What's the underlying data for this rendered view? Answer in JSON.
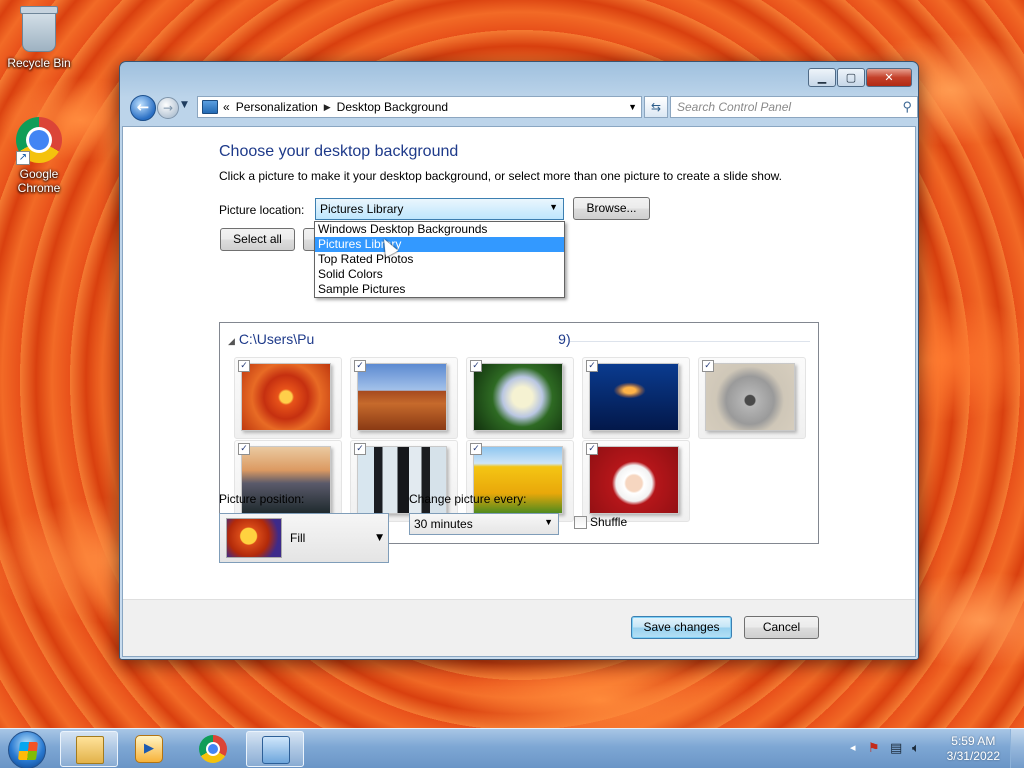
{
  "desktop": {
    "icons": [
      {
        "label": "Recycle Bin",
        "icon": "recycle-bin-icon"
      },
      {
        "label": "Google\nChrome",
        "icon": "chrome-icon"
      }
    ]
  },
  "window": {
    "address": {
      "overflow": "«",
      "crumbs": [
        "Personalization",
        "Desktop Background"
      ],
      "search_placeholder": "Search Control Panel"
    },
    "heading": "Choose your desktop background",
    "description": "Click a picture to make it your desktop background, or select more than one picture to create a slide show.",
    "picture_location_label": "Picture location:",
    "picture_location_value": "Pictures Library",
    "browse_label": "Browse...",
    "select_all_label": "Select all",
    "group_header": "C:\\Users\\Pu",
    "group_header_tail": "9)",
    "dropdown_options": [
      "Windows Desktop Backgrounds",
      "Pictures Library",
      "Top Rated Photos",
      "Solid Colors",
      "Sample Pictures"
    ],
    "dropdown_selected_index": 1,
    "pictures": [
      {
        "name": "Chrysanthemum",
        "checked": true
      },
      {
        "name": "Desert",
        "checked": true
      },
      {
        "name": "Hydrangeas",
        "checked": true
      },
      {
        "name": "Jellyfish",
        "checked": true
      },
      {
        "name": "Koala",
        "checked": true
      },
      {
        "name": "Lighthouse",
        "checked": true
      },
      {
        "name": "Penguins",
        "checked": true
      },
      {
        "name": "Tulips",
        "checked": true
      },
      {
        "name": "Santa",
        "checked": true
      }
    ],
    "picture_position_label": "Picture position:",
    "picture_position_value": "Fill",
    "change_every_label": "Change picture every:",
    "change_every_value": "30 minutes",
    "shuffle_label": "Shuffle",
    "shuffle_checked": false,
    "save_label": "Save changes",
    "cancel_label": "Cancel"
  },
  "taskbar": {
    "clock_time": "5:59 AM",
    "clock_date": "3/31/2022"
  }
}
